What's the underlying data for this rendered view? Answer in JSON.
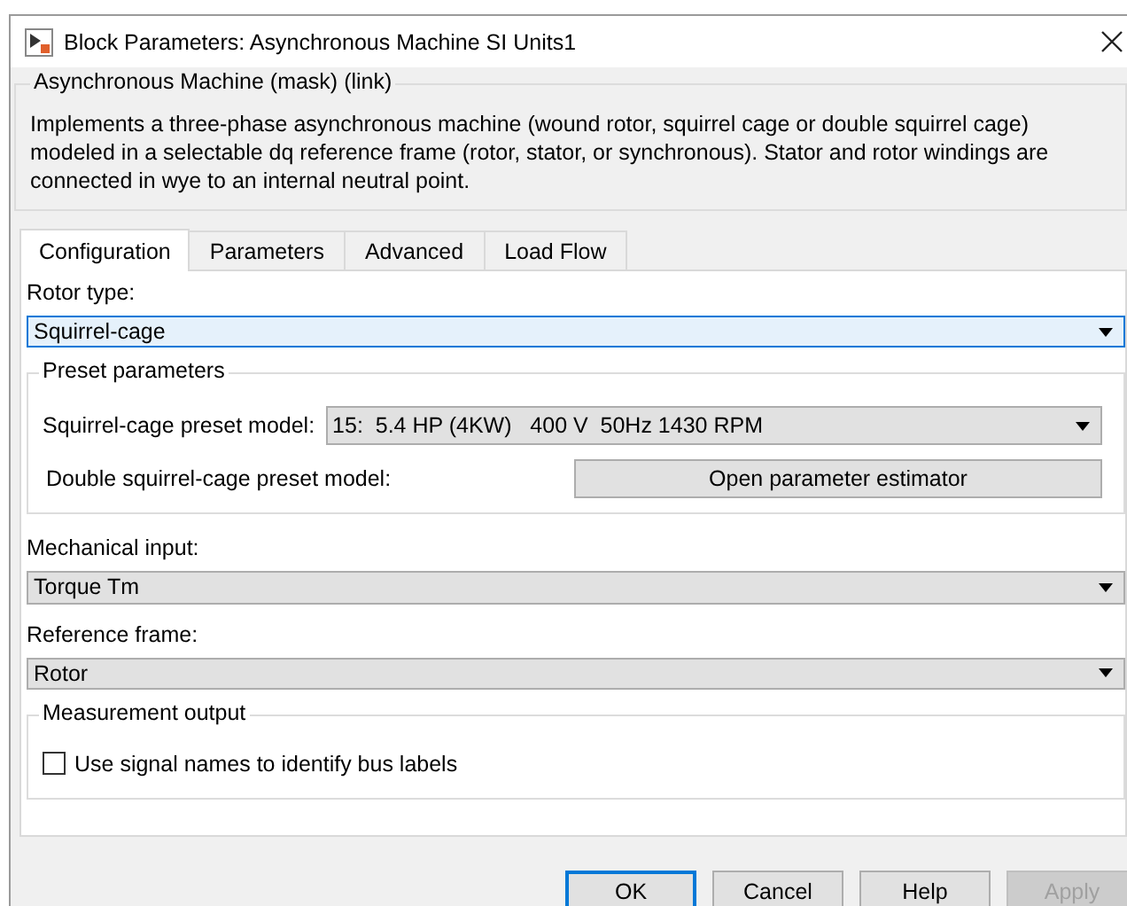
{
  "window": {
    "title": "Block Parameters: Asynchronous Machine SI Units1"
  },
  "mask": {
    "title": "Asynchronous Machine (mask) (link)",
    "description": "Implements a three-phase asynchronous machine (wound rotor, squirrel cage or double squirrel cage) modeled in a selectable dq reference frame (rotor, stator, or synchronous). Stator and rotor windings are connected in wye to an internal neutral point."
  },
  "tabs": [
    {
      "label": "Configuration",
      "selected": true
    },
    {
      "label": "Parameters",
      "selected": false
    },
    {
      "label": "Advanced",
      "selected": false
    },
    {
      "label": "Load Flow",
      "selected": false
    }
  ],
  "rotor_type": {
    "label": "Rotor type:",
    "value": "Squirrel-cage",
    "focused": true
  },
  "preset_parameters": {
    "title": "Preset parameters",
    "squirrel_cage": {
      "label": "Squirrel-cage preset model:",
      "value": "15:  5.4 HP (4KW)   400 V  50Hz 1430 RPM"
    },
    "double_squirrel_cage": {
      "label": "Double squirrel-cage preset model:",
      "button": "Open parameter estimator"
    }
  },
  "mechanical_input": {
    "label": "Mechanical input:",
    "value": "Torque Tm",
    "focused": false
  },
  "reference_frame": {
    "label": "Reference frame:",
    "value": "Rotor",
    "focused": false
  },
  "measurement_output": {
    "title": "Measurement output",
    "checkbox": {
      "label": "Use signal names to identify bus labels",
      "checked": false
    }
  },
  "buttons": [
    {
      "label": "OK",
      "disabled": false,
      "default": true
    },
    {
      "label": "Cancel",
      "disabled": false,
      "default": false
    },
    {
      "label": "Help",
      "disabled": false,
      "default": false
    },
    {
      "label": "Apply",
      "disabled": true,
      "default": false
    }
  ]
}
